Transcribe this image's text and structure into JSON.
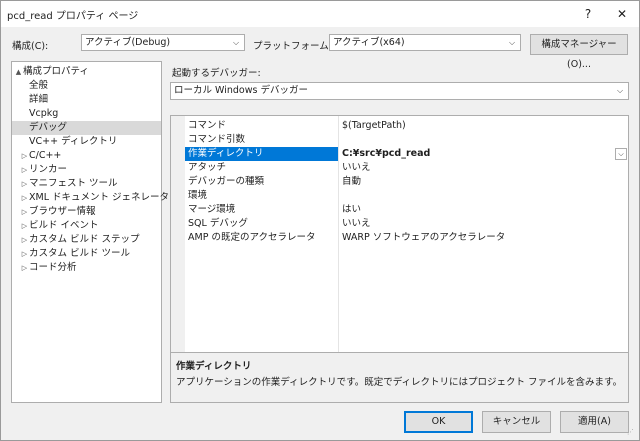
{
  "window": {
    "title": "pcd_read プロパティ ページ",
    "help": "?",
    "close": "✕"
  },
  "config": {
    "label": "構成(C):",
    "value": "アクティブ(Debug)",
    "platform_label": "プラットフォーム(P):",
    "platform_value": "アクティブ(x64)",
    "manager_button": "構成マネージャー(O)..."
  },
  "tree": {
    "items": [
      {
        "label": "構成プロパティ",
        "expander": "▲"
      },
      {
        "label": "全般"
      },
      {
        "label": "詳細"
      },
      {
        "label": "Vcpkg"
      },
      {
        "label": "デバッグ"
      },
      {
        "label": "VC++ ディレクトリ"
      },
      {
        "label": "C/C++",
        "expander": "▷"
      },
      {
        "label": "リンカー",
        "expander": "▷"
      },
      {
        "label": "マニフェスト ツール",
        "expander": "▷"
      },
      {
        "label": "XML ドキュメント ジェネレーター",
        "expander": "▷"
      },
      {
        "label": "ブラウザー情報",
        "expander": "▷"
      },
      {
        "label": "ビルド イベント",
        "expander": "▷"
      },
      {
        "label": "カスタム ビルド ステップ",
        "expander": "▷"
      },
      {
        "label": "カスタム ビルド ツール",
        "expander": "▷"
      },
      {
        "label": "コード分析",
        "expander": "▷"
      }
    ]
  },
  "debugger": {
    "label": "起動するデバッガー:",
    "value": "ローカル Windows デバッガー"
  },
  "properties": {
    "rows": [
      {
        "name": "コマンド",
        "value": "$(TargetPath)"
      },
      {
        "name": "コマンド引数",
        "value": ""
      },
      {
        "name": "作業ディレクトリ",
        "value": "C:¥src¥pcd_read"
      },
      {
        "name": "アタッチ",
        "value": "いいえ"
      },
      {
        "name": "デバッガーの種類",
        "value": "自動"
      },
      {
        "name": "環境",
        "value": ""
      },
      {
        "name": "マージ環境",
        "value": "はい"
      },
      {
        "name": "SQL デバッグ",
        "value": "いいえ"
      },
      {
        "name": "AMP の既定のアクセラレータ",
        "value": "WARP ソフトウェアのアクセラレータ"
      }
    ]
  },
  "description": {
    "title": "作業ディレクトリ",
    "text": "アプリケーションの作業ディレクトリです。既定でディレクトリにはプロジェクト ファイルを含みます。"
  },
  "buttons": {
    "ok": "OK",
    "cancel": "キャンセル",
    "apply": "適用(A)"
  },
  "icons": {
    "chevron": "⌵"
  }
}
